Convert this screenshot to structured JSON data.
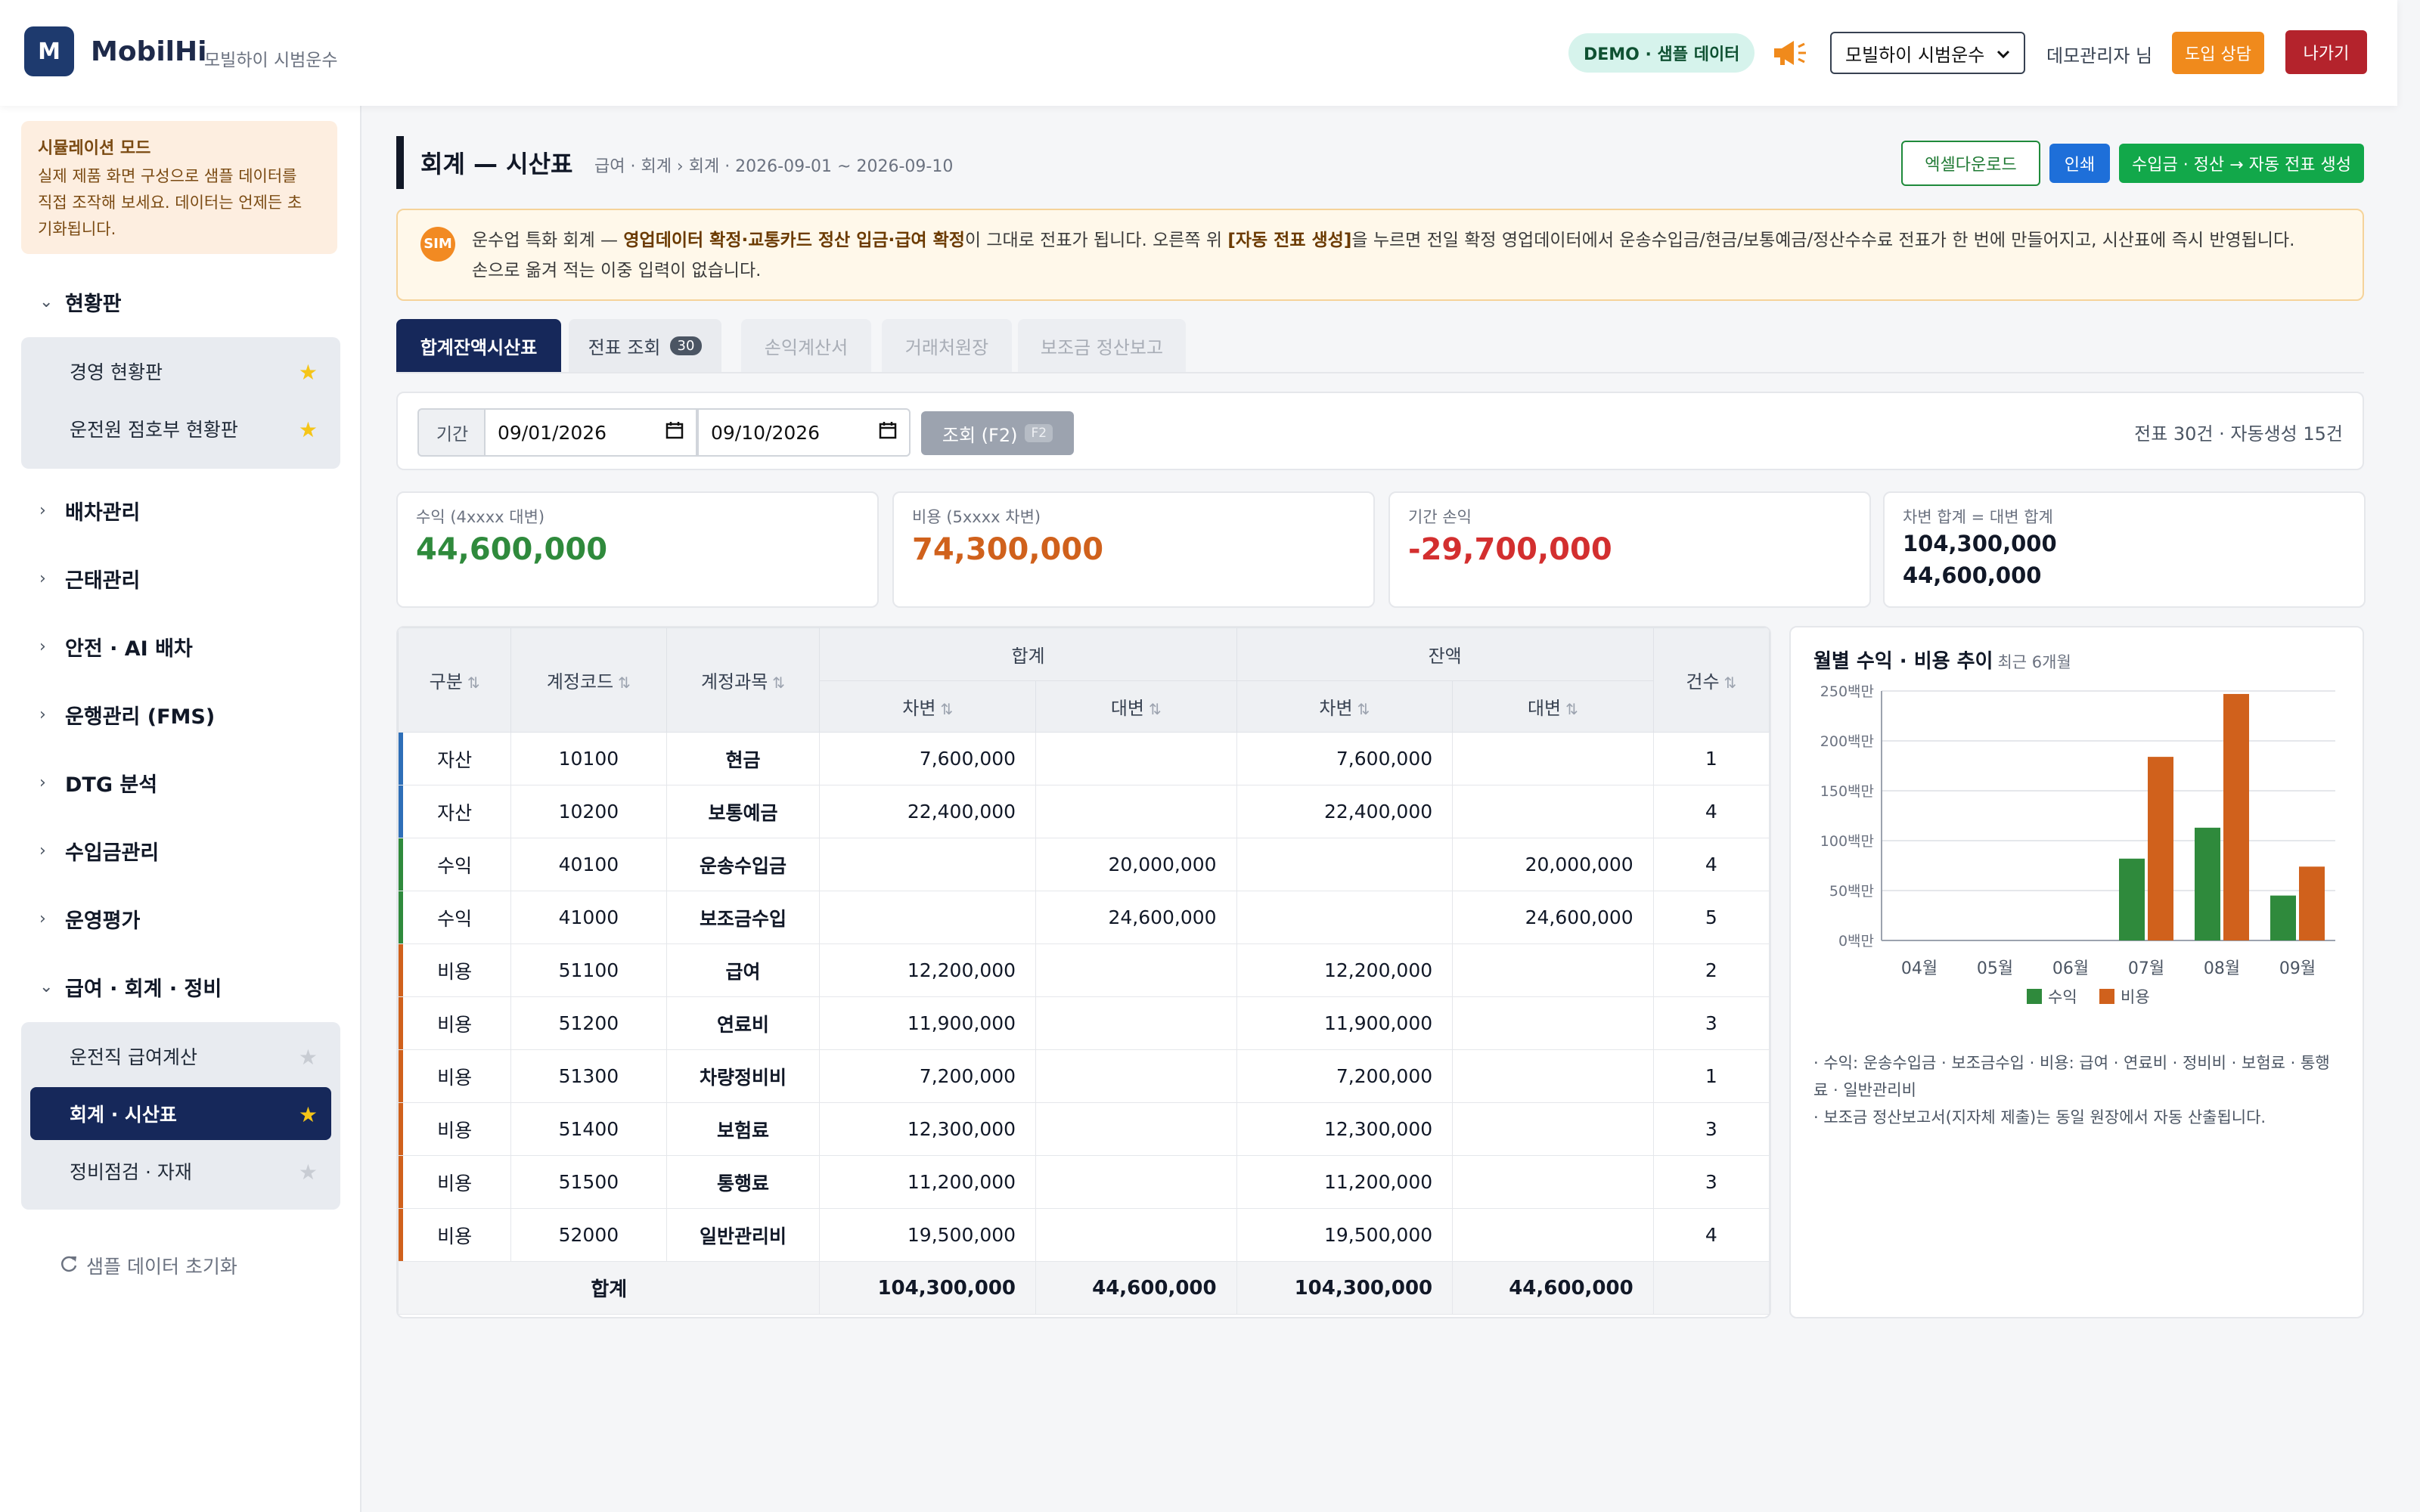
{
  "header": {
    "logo_letter": "M",
    "brand": "MobilHi",
    "brand_sub": "모빌하이 시범운수",
    "demo_badge": "DEMO · 샘플 데이터",
    "company_select": "모빌하이 시범운수",
    "user": "데모관리자 님",
    "consult_btn": "도입 상담",
    "exit_btn": "나가기"
  },
  "sidebar": {
    "sim_title": "시뮬레이션 모드",
    "sim_lines": [
      "실제 제품 화면 구성으로 샘플 데이터를",
      "직접 조작해 보세요. 데이터는 언제든 초",
      "기화됩니다."
    ],
    "groups": {
      "dashboard": "현황판",
      "dispatch": "배차관리",
      "attendance": "근태관리",
      "safety": "안전 · AI 배차",
      "fms": "운행관리 (FMS)",
      "dtg": "DTG 분석",
      "revenue": "수입금관리",
      "evaluation": "운영평가",
      "payroll": "급여 · 회계 · 정비"
    },
    "dashboard_items": [
      "경영 현황판",
      "운전원 점호부 현황판"
    ],
    "payroll_items": [
      "운전직 급여계산",
      "회계 · 시산표",
      "정비점검 · 자재"
    ],
    "reset": "샘플 데이터 초기화"
  },
  "page": {
    "title": "회계 — 시산표",
    "breadcrumb": "급여 · 회계 › 회계 · 2026-09-01 ~ 2026-09-10",
    "excel_btn": "엑셀다운로드",
    "print_btn": "인쇄",
    "auto_btn": "수입금 · 정산 → 자동 전표 생성"
  },
  "notice": {
    "icon": "SIM",
    "t1": "운수업 특화 회계 — ",
    "b1": "영업데이터 확정·교통카드 정산 입금·급여 확정",
    "t2": "이 그대로 전표가 됩니다. 오른쪽 위 ",
    "b2": "[자동 전표 생성]",
    "t3": "을 누르면 전일 확정 영업데이터에서 운송수입금/현금/보통예금/정산수수료 전표가 한 번에 만들어지고, 시산표에 즉시 반영됩니다.",
    "t4": "손으로 옮겨 적는 이중 입력이 없습니다."
  },
  "tabs": [
    "합계잔액시산표",
    "전표 조회",
    "손익계산서",
    "거래처원장",
    "보조금 정산보고"
  ],
  "tab_badge": "30",
  "filter": {
    "label": "기간",
    "from": "09/01/2026",
    "to": "09/10/2026",
    "search_btn": "조회 (F2)",
    "key": "F2",
    "summary": "전표 30건 · 자동생성 15건"
  },
  "cards": {
    "revenue_label": "수익 (4xxxx 대변)",
    "revenue_value": "44,600,000",
    "expense_label": "비용 (5xxxx 차변)",
    "expense_value": "74,300,000",
    "pl_label": "기간 손익",
    "pl_value": "-29,700,000",
    "balance_label": "차변 합계 = 대변 합계",
    "balance_debit": "104,300,000",
    "balance_credit": "44,600,000"
  },
  "table": {
    "headers": {
      "type": "구분",
      "code": "계정코드",
      "name": "계정과목",
      "sum": "합계",
      "balance": "잔액",
      "count": "건수",
      "debit": "차변",
      "credit": "대변"
    },
    "rows": [
      {
        "type": "자산",
        "code": "10100",
        "name": "현금",
        "sum_debit": "7,600,000",
        "sum_credit": "",
        "bal_debit": "7,600,000",
        "bal_credit": "",
        "count": "1"
      },
      {
        "type": "자산",
        "code": "10200",
        "name": "보통예금",
        "sum_debit": "22,400,000",
        "sum_credit": "",
        "bal_debit": "22,400,000",
        "bal_credit": "",
        "count": "4"
      },
      {
        "type": "수익",
        "code": "40100",
        "name": "운송수입금",
        "sum_debit": "",
        "sum_credit": "20,000,000",
        "bal_debit": "",
        "bal_credit": "20,000,000",
        "count": "4"
      },
      {
        "type": "수익",
        "code": "41000",
        "name": "보조금수입",
        "sum_debit": "",
        "sum_credit": "24,600,000",
        "bal_debit": "",
        "bal_credit": "24,600,000",
        "count": "5"
      },
      {
        "type": "비용",
        "code": "51100",
        "name": "급여",
        "sum_debit": "12,200,000",
        "sum_credit": "",
        "bal_debit": "12,200,000",
        "bal_credit": "",
        "count": "2"
      },
      {
        "type": "비용",
        "code": "51200",
        "name": "연료비",
        "sum_debit": "11,900,000",
        "sum_credit": "",
        "bal_debit": "11,900,000",
        "bal_credit": "",
        "count": "3"
      },
      {
        "type": "비용",
        "code": "51300",
        "name": "차량정비비",
        "sum_debit": "7,200,000",
        "sum_credit": "",
        "bal_debit": "7,200,000",
        "bal_credit": "",
        "count": "1"
      },
      {
        "type": "비용",
        "code": "51400",
        "name": "보험료",
        "sum_debit": "12,300,000",
        "sum_credit": "",
        "bal_debit": "12,300,000",
        "bal_credit": "",
        "count": "3"
      },
      {
        "type": "비용",
        "code": "51500",
        "name": "통행료",
        "sum_debit": "11,200,000",
        "sum_credit": "",
        "bal_debit": "11,200,000",
        "bal_credit": "",
        "count": "3"
      },
      {
        "type": "비용",
        "code": "52000",
        "name": "일반관리비",
        "sum_debit": "19,500,000",
        "sum_credit": "",
        "bal_debit": "19,500,000",
        "bal_credit": "",
        "count": "4"
      }
    ],
    "total": {
      "label": "합계",
      "sum_debit": "104,300,000",
      "sum_credit": "44,600,000",
      "bal_debit": "104,300,000",
      "bal_credit": "44,600,000"
    }
  },
  "colors": {
    "navy": "#16285a",
    "revenue": "#2f8a3c",
    "expense": "#d0611c",
    "loss": "#d32f2f",
    "asset": "#2e6fb8"
  },
  "chart_panel": {
    "title": "월별 수익 · 비용 추이",
    "subtitle": "최근 6개월",
    "notes": [
      "· 수익: 운송수입금 · 보조금수입   · 비용: 급여 · 연료비 · 정비비 · 보험료 · 통행료 · 일반관리비",
      "· 보조금 정산보고서(지자체 제출)는 동일 원장에서 자동 산출됩니다."
    ]
  },
  "chart_data": {
    "type": "bar",
    "title": "월별 수익 · 비용 추이",
    "categories": [
      "04월",
      "05월",
      "06월",
      "07월",
      "08월",
      "09월"
    ],
    "series": [
      {
        "name": "수익",
        "color": "#2f8a3c",
        "values": [
          0,
          0,
          0,
          82,
          113,
          45
        ]
      },
      {
        "name": "비용",
        "color": "#d0611c",
        "values": [
          0,
          0,
          0,
          184,
          247,
          74
        ]
      }
    ],
    "yticks": [
      "0백만",
      "50백만",
      "100백만",
      "150백만",
      "200백만",
      "250백만"
    ],
    "ylim": [
      0,
      250
    ],
    "grid": true,
    "legend": "bottom"
  }
}
